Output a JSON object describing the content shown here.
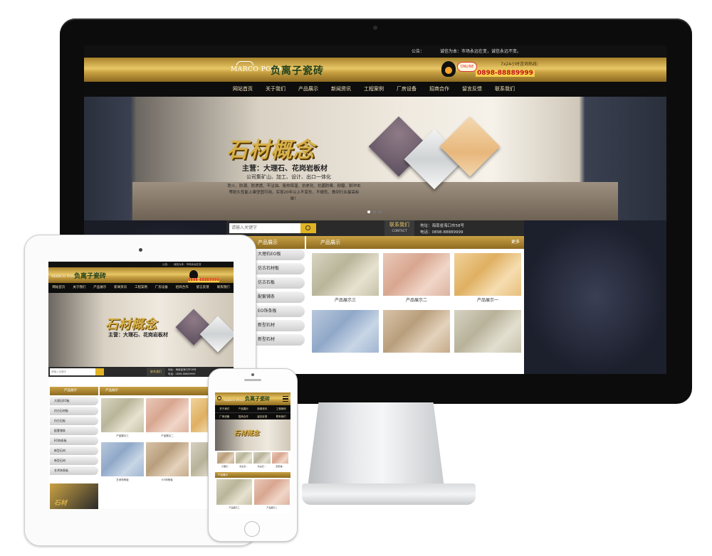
{
  "desktop": {
    "topbar": {
      "notice": "公告：",
      "message": "诚信为本：市场永远在变，诚信永远不变。"
    },
    "logo": {
      "en": "MARCO POLO",
      "cn": "负离子瓷砖"
    },
    "online_badge": "ONLINE",
    "hotline_label": "7x24小时咨询热线：",
    "hotline": "0898-88889999",
    "nav": [
      "网站首页",
      "关于我们",
      "产品展示",
      "新闻资讯",
      "工程案例",
      "厂房设备",
      "招商合作",
      "留言反馈",
      "联系我们"
    ],
    "banner": {
      "title": "石材概念",
      "subtitle": "主营：大理石、花岗岩板材",
      "slogan": "公司集矿山、加工、设计、出口一体化",
      "desc": "防火、防潮、防渗透、不沾油、易热保温、抗老化、抗菌防霉、耐磨、耐冲击等耐久性能上乘坚固可用，实现20年以上不变形、不褪色，做到行业最高标准！"
    },
    "search": {
      "placeholder": "请输入关键字"
    },
    "contact": {
      "title": "联系我们",
      "en": "CONTACT",
      "address": "地址：海南省海口市58号",
      "phone": "电话：0898-88889999"
    },
    "sidebar": {
      "title": "产品展示",
      "items": [
        "大理石EO板",
        "仿古石材板",
        "仿古石板",
        "配套铺条",
        "EO饰条板",
        "新型石材",
        "新型石材"
      ]
    },
    "products": {
      "title": "产品展示",
      "more": "更多",
      "items": [
        {
          "caption": "产品展示三"
        },
        {
          "caption": "产品展示二"
        },
        {
          "caption": "产品展示一"
        },
        {
          "caption": ""
        },
        {
          "caption": ""
        },
        {
          "caption": ""
        }
      ]
    }
  },
  "tablet": {
    "topbar": {
      "notice": "公告：",
      "message": "诚信为本：市场永远在变"
    },
    "logo": {
      "en": "MARCO POLO",
      "cn": "负离子瓷砖"
    },
    "hotline": "0898-88889999",
    "nav": [
      "网站首页",
      "关于我们",
      "产品展示",
      "新闻资讯",
      "工程案例",
      "厂房设备",
      "招商合作",
      "留言反馈",
      "联系我们"
    ],
    "banner": {
      "title": "石材概念",
      "subtitle": "主营：大理石、花岗岩板材"
    },
    "search": {
      "placeholder": "请输入关键字"
    },
    "contact": {
      "title": "联系我们",
      "address": "地址：海南省海口市58号",
      "phone": "电话：0898-88889999"
    },
    "sidebar": {
      "title": "产品展示",
      "items": [
        "大理石EO板",
        "仿古石材板",
        "仿古石板",
        "配套铺条",
        "EO饰条板",
        "新型石材",
        "新型石材",
        "艺术饰条板"
      ],
      "promo": "石材"
    },
    "products": {
      "title": "产品展示",
      "items": [
        {
          "caption": "产品展示三"
        },
        {
          "caption": "产品展示二"
        },
        {
          "caption": ""
        },
        {
          "caption": "艺术饰条板"
        },
        {
          "caption": "EO饰条板"
        },
        {
          "caption": "新型"
        }
      ]
    }
  },
  "phone": {
    "logo": {
      "en": "MARCO POLO",
      "cn": "负离子瓷砖"
    },
    "nav": [
      "关于我们",
      "产品展示",
      "新闻资讯",
      "工程案例",
      "厂房设备",
      "招商合作",
      "留言反馈",
      "联系我们"
    ],
    "banner": {
      "title": "石材概念"
    },
    "thumbs": [
      {
        "caption": "大理石..."
      },
      {
        "caption": "仿古石..."
      },
      {
        "caption": "仿古石..."
      },
      {
        "caption": "配套铺..."
      }
    ],
    "products": {
      "title": "产品展示",
      "items": [
        {
          "caption": "产品展示三"
        },
        {
          "caption": "产品展示二"
        }
      ]
    }
  }
}
